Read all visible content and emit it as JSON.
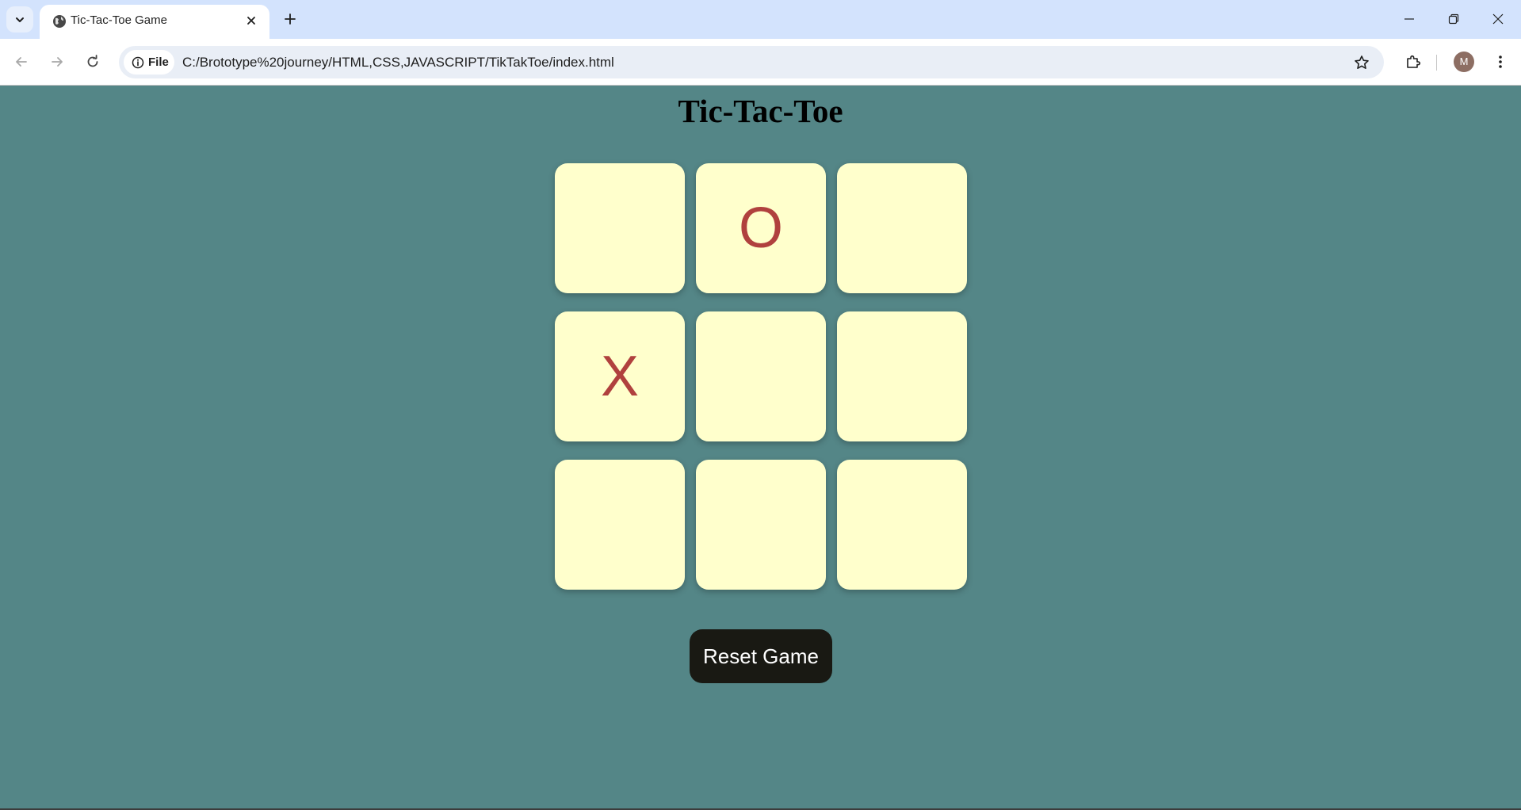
{
  "browser": {
    "tab_title": "Tic-Tac-Toe Game",
    "site_chip_label": "File",
    "url": "C:/Brototype%20journey/HTML,CSS,JAVASCRIPT/TikTakToe/index.html",
    "avatar_letter": "M"
  },
  "page": {
    "title": "Tic-Tac-Toe",
    "board": [
      "",
      "O",
      "",
      "X",
      "",
      "",
      "",
      "",
      ""
    ],
    "reset_label": "Reset Game"
  },
  "colors": {
    "background": "#548687",
    "cell": "#ffffcc",
    "mark": "#b0413e",
    "button": "#191913"
  }
}
